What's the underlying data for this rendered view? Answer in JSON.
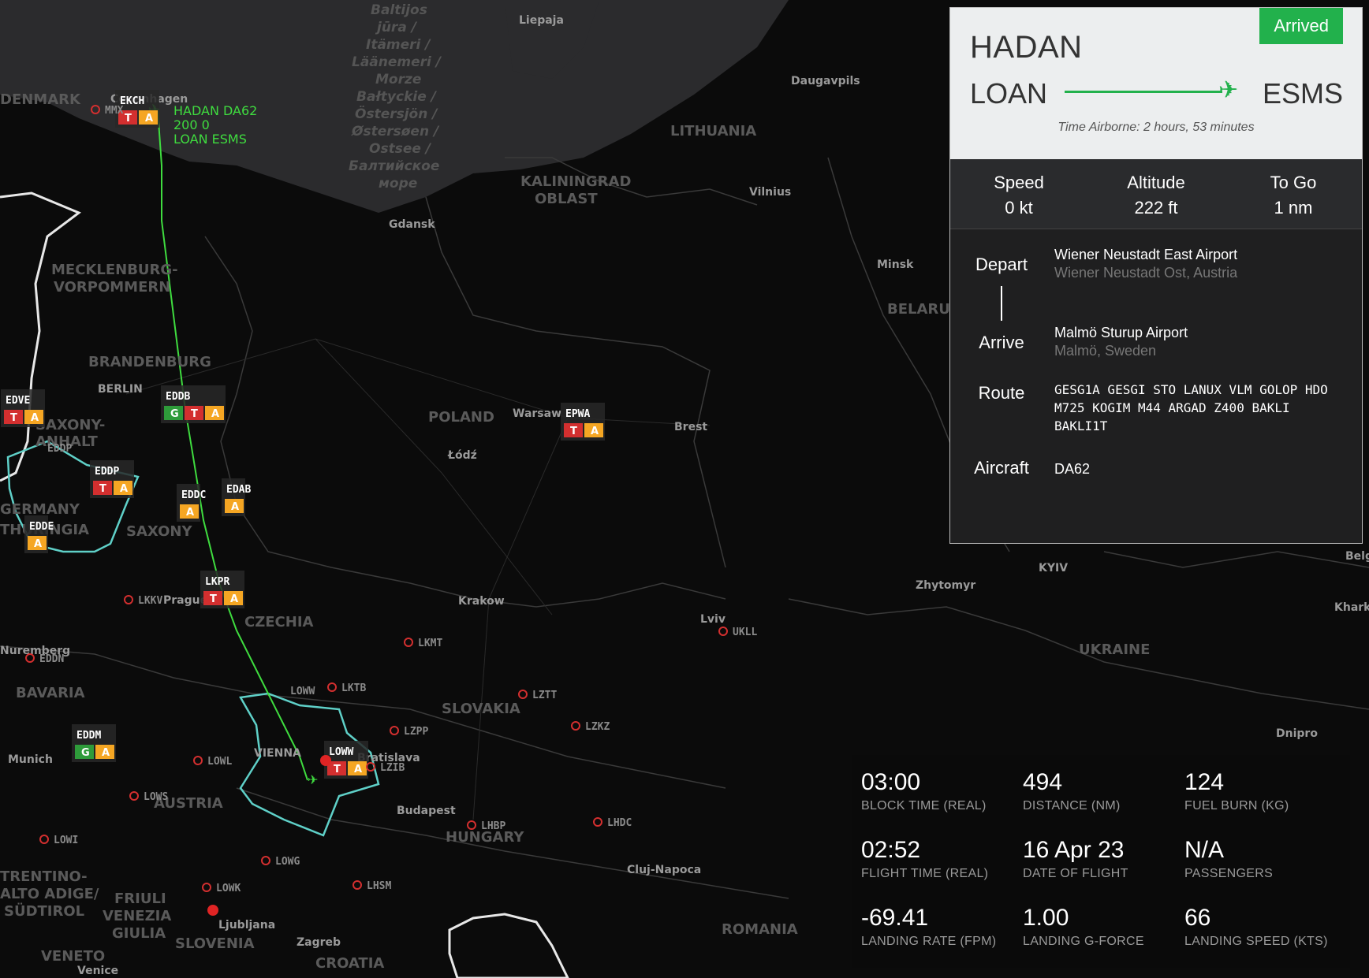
{
  "map": {
    "regions": [
      "LITHUANIA",
      "KALININGRAD",
      "OBLAST",
      "MECKLENBURG-",
      "VORPOMMERN",
      "BRANDENBURG",
      "POLAND",
      "BELARUS",
      "SAXONY-",
      "ANHALT",
      "GERMANY",
      "THURINGIA",
      "SAXONY",
      "CZECHIA",
      "BAVARIA",
      "SLOVAKIA",
      "AUSTRIA",
      "HUNGARY",
      "UKRAINE",
      "ROMANIA",
      "SLOVENIA",
      "CROATIA",
      "TRENTINO-",
      "ALTO ADIGE/",
      "SÜDTIROL",
      "FRIULI",
      "VENEZIA",
      "GIULIA",
      "VENETO",
      "DENMARK"
    ],
    "cities": [
      "Liepaja",
      "Copenhagen",
      "Daugavpils",
      "Vilnius",
      "Gdansk",
      "Minsk",
      "BERLIN",
      "Warsaw",
      "Brest",
      "Łódź",
      "Prague",
      "Krakow",
      "Lviv",
      "Zhytomyr",
      "KYIV",
      "Kharkiv",
      "Munich",
      "VIENNA",
      "Bratislava",
      "Budapest",
      "Cluj-Napoca",
      "Dnipro",
      "Ljubljana",
      "Zagreb",
      "Venice",
      "Nuremberg",
      "Belg"
    ],
    "sea": [
      "Baltijos",
      "jūra /",
      "Itämeri /",
      "Läänemeri /",
      "Morze",
      "Bałtyckie /",
      "Östersjön /",
      "Østersøen /",
      "Ostsee /",
      "Балтийское",
      "море"
    ],
    "airports": [
      "EKCH",
      "EDDB",
      "EPWA",
      "EDVE",
      "EDDP",
      "EDDE",
      "EDDC",
      "EDAB",
      "LKPR",
      "LOWW",
      "EDDM",
      "LKKV",
      "EDDN",
      "LKMT",
      "LKTB",
      "LZTT",
      "LZPP",
      "LZKZ",
      "LZIB",
      "LOWL",
      "LOWS",
      "LOWI",
      "LOWG",
      "LOWK",
      "LHBP",
      "LHDC",
      "LHSM",
      "UKLL",
      "MMX"
    ],
    "flight_label": [
      "HADAN DA62",
      "200 0",
      "LOAN ESMS"
    ]
  },
  "panel": {
    "callsign": "HADAN",
    "status": "Arrived",
    "origin": "LOAN",
    "destination": "ESMS",
    "plane_icon": "airplane-icon",
    "airborne": "Time Airborne: 2 hours, 53 minutes",
    "stats": [
      {
        "label": "Speed",
        "value": "0 kt"
      },
      {
        "label": "Altitude",
        "value": "222 ft"
      },
      {
        "label": "To Go",
        "value": "1 nm"
      }
    ],
    "depart_label": "Depart",
    "depart_name": "Wiener Neustadt East Airport",
    "depart_loc": "Wiener Neustadt Ost, Austria",
    "arrive_label": "Arrive",
    "arrive_name": "Malmö Sturup Airport",
    "arrive_loc": "Malmö, Sweden",
    "route_label": "Route",
    "route": "GESG1A GESGI STO LANUX VLM GOLOP HDO M725 KOGIM M44 ARGAD Z400 BAKLI BAKLI1T",
    "aircraft_label": "Aircraft",
    "aircraft": "DA62"
  },
  "metrics": [
    {
      "value": "03:00",
      "label": "BLOCK TIME (REAL)"
    },
    {
      "value": "494",
      "label": "DISTANCE (NM)"
    },
    {
      "value": "124",
      "label": "FUEL BURN (KG)"
    },
    {
      "value": "02:52",
      "label": "FLIGHT TIME (REAL)"
    },
    {
      "value": "16 Apr 23",
      "label": "DATE OF FLIGHT"
    },
    {
      "value": "N/A",
      "label": "PASSENGERS"
    },
    {
      "value": "-69.41",
      "label": "LANDING RATE (FPM)"
    },
    {
      "value": "1.00",
      "label": "LANDING G-FORCE"
    },
    {
      "value": "66",
      "label": "LANDING SPEED (KTS)"
    }
  ],
  "colors": {
    "accent": "#22b14c",
    "track": "#3fdc3f",
    "fir": "#5fd0c8",
    "tower": "#d32f2f",
    "approach": "#f5a623",
    "ground": "#2e9b3a"
  }
}
